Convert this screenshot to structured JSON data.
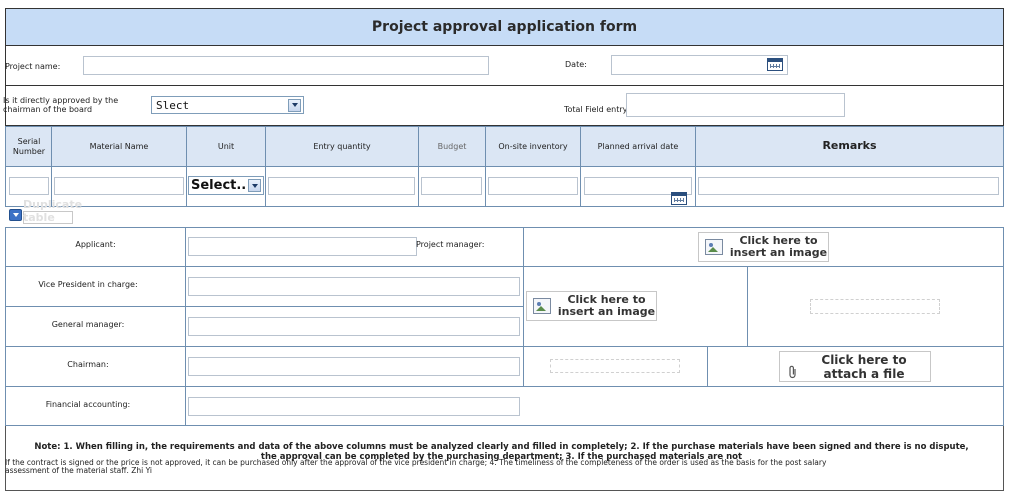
{
  "form": {
    "title": "Project approval application form",
    "project_name_label": "Project name:",
    "date_label": "Date:",
    "board_label": "Is it directly approved by the chairman of the board",
    "board_select_value": "Slect",
    "total_field_label": "Total Field entry"
  },
  "materials": {
    "headers": {
      "serial": "Serial Number",
      "material": "Material Name",
      "unit": "Unit",
      "entry_qty": "Entry quantity",
      "budget": "Budget",
      "onsite": "On-site inventory",
      "arrival": "Planned arrival date",
      "remarks": "Remarks"
    },
    "unit_select_value": "Select..",
    "duplicate_label": "Duplicate table"
  },
  "approvals": {
    "applicant": "Applicant:",
    "project_manager": "Project manager:",
    "vice_president": "Vice President in charge:",
    "general_manager": "General manager:",
    "chairman": "Chairman:",
    "financial": "Financial accounting:",
    "insert_image": "Click here to insert an image",
    "attach_file": "Click here to attach a file"
  },
  "note": {
    "line1": "Note: 1. When filling in, the requirements and data of the above columns must be analyzed clearly and filled in completely; 2. If the purchase materials have been signed and there is no dispute,",
    "line2": "the approval can be completed by the purchasing department; 3. If the purchased materials are not",
    "line3": "If the contract is signed or the price is not approved, it can be purchased only after the approval of the vice president in charge; 4. The timeliness of the completeness of the order is used as the basis for the post salary",
    "line4": "assessment of the material staff. Zhi Yi"
  },
  "colors": {
    "title_bar": "#c6dcf6",
    "table_header": "#dbe6f4",
    "grid_line": "#6f8fb0"
  },
  "icons": [
    "calendar-icon",
    "dropdown-arrow-icon",
    "image-icon",
    "paperclip-icon",
    "duplicate-table-icon"
  ]
}
